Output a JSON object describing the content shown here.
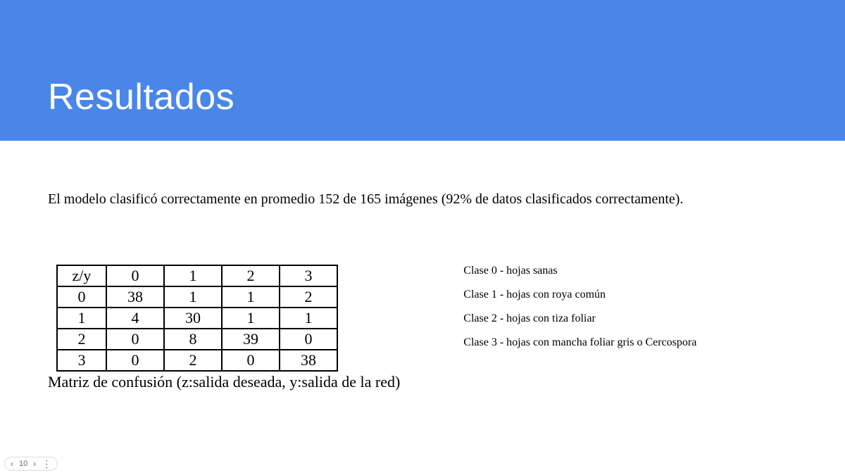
{
  "header": {
    "title": "Resultados"
  },
  "intro": "El modelo clasificó correctamente en promedio 152 de 165 imágenes (92% de datos clasificados correctamente).",
  "table": {
    "corner": "z/y",
    "col_headers": [
      "0",
      "1",
      "2",
      "3"
    ],
    "rows": [
      {
        "label": "0",
        "cells": [
          "38",
          "1",
          "1",
          "2"
        ]
      },
      {
        "label": "1",
        "cells": [
          "4",
          "30",
          "1",
          "1"
        ]
      },
      {
        "label": "2",
        "cells": [
          "0",
          "8",
          "39",
          "0"
        ]
      },
      {
        "label": "3",
        "cells": [
          "0",
          "2",
          "0",
          "38"
        ]
      }
    ],
    "caption": "Matriz de confusión (z:salida deseada, y:salida de la red)"
  },
  "legend": [
    "Clase 0 - hojas sanas",
    "Clase 1 - hojas con roya común",
    "Clase 2 - hojas con tiza foliar",
    "Clase 3 - hojas con mancha foliar gris o Cercospora"
  ],
  "nav": {
    "prev": "‹",
    "page": "10",
    "next": "›",
    "menu": "⋮"
  }
}
